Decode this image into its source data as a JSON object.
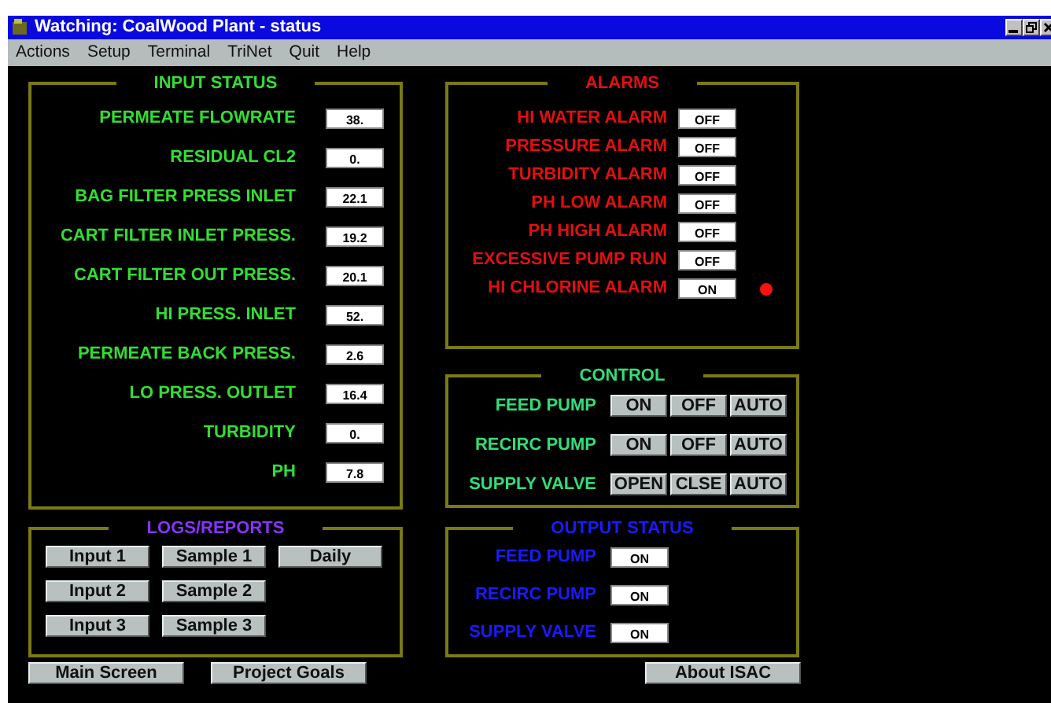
{
  "window": {
    "title": "Watching: CoalWood Plant - status"
  },
  "menu": [
    "Actions",
    "Setup",
    "Terminal",
    "TriNet",
    "Quit",
    "Help"
  ],
  "input_status": {
    "title": "INPUT STATUS",
    "rows": [
      {
        "label": "PERMEATE FLOWRATE",
        "value": "38."
      },
      {
        "label": "RESIDUAL CL2",
        "value": "0."
      },
      {
        "label": "BAG FILTER PRESS INLET",
        "value": "22.1"
      },
      {
        "label": "CART FILTER INLET PRESS.",
        "value": "19.2"
      },
      {
        "label": "CART FILTER OUT PRESS.",
        "value": "20.1"
      },
      {
        "label": "HI PRESS. INLET",
        "value": "52."
      },
      {
        "label": "PERMEATE BACK PRESS.",
        "value": "2.6"
      },
      {
        "label": "LO PRESS. OUTLET",
        "value": "16.4"
      },
      {
        "label": "TURBIDITY",
        "value": "0."
      },
      {
        "label": "PH",
        "value": "7.8"
      }
    ]
  },
  "alarms": {
    "title": "ALARMS",
    "rows": [
      {
        "label": "HI WATER ALARM",
        "value": "OFF",
        "lamp_on": false
      },
      {
        "label": "PRESSURE ALARM",
        "value": "OFF",
        "lamp_on": false
      },
      {
        "label": "TURBIDITY ALARM",
        "value": "OFF",
        "lamp_on": false
      },
      {
        "label": "PH LOW ALARM",
        "value": "OFF",
        "lamp_on": false
      },
      {
        "label": "PH HIGH ALARM",
        "value": "OFF",
        "lamp_on": false
      },
      {
        "label": "EXCESSIVE PUMP RUN",
        "value": "OFF",
        "lamp_on": false
      },
      {
        "label": "HI CHLORINE ALARM",
        "value": "ON",
        "lamp_on": true
      }
    ]
  },
  "control": {
    "title": "CONTROL",
    "rows": [
      {
        "label": "FEED PUMP",
        "buttons": [
          "ON",
          "OFF",
          "AUTO"
        ]
      },
      {
        "label": "RECIRC PUMP",
        "buttons": [
          "ON",
          "OFF",
          "AUTO"
        ]
      },
      {
        "label": "SUPPLY VALVE",
        "buttons": [
          "OPEN",
          "CLSE",
          "AUTO"
        ]
      }
    ]
  },
  "output_status": {
    "title": "OUTPUT STATUS",
    "rows": [
      {
        "label": "FEED PUMP",
        "value": "ON"
      },
      {
        "label": "RECIRC PUMP",
        "value": "ON"
      },
      {
        "label": "SUPPLY VALVE",
        "value": "ON"
      }
    ]
  },
  "logs_reports": {
    "title": "LOGS/REPORTS",
    "button_rows": [
      [
        "Input 1",
        "Sample 1",
        "Daily"
      ],
      [
        "Input 2",
        "Sample 2"
      ],
      [
        "Input 3",
        "Sample 3"
      ]
    ]
  },
  "bottom_buttons": {
    "left": [
      "Main Screen",
      "Project Goals"
    ],
    "right": [
      "About ISAC"
    ]
  }
}
